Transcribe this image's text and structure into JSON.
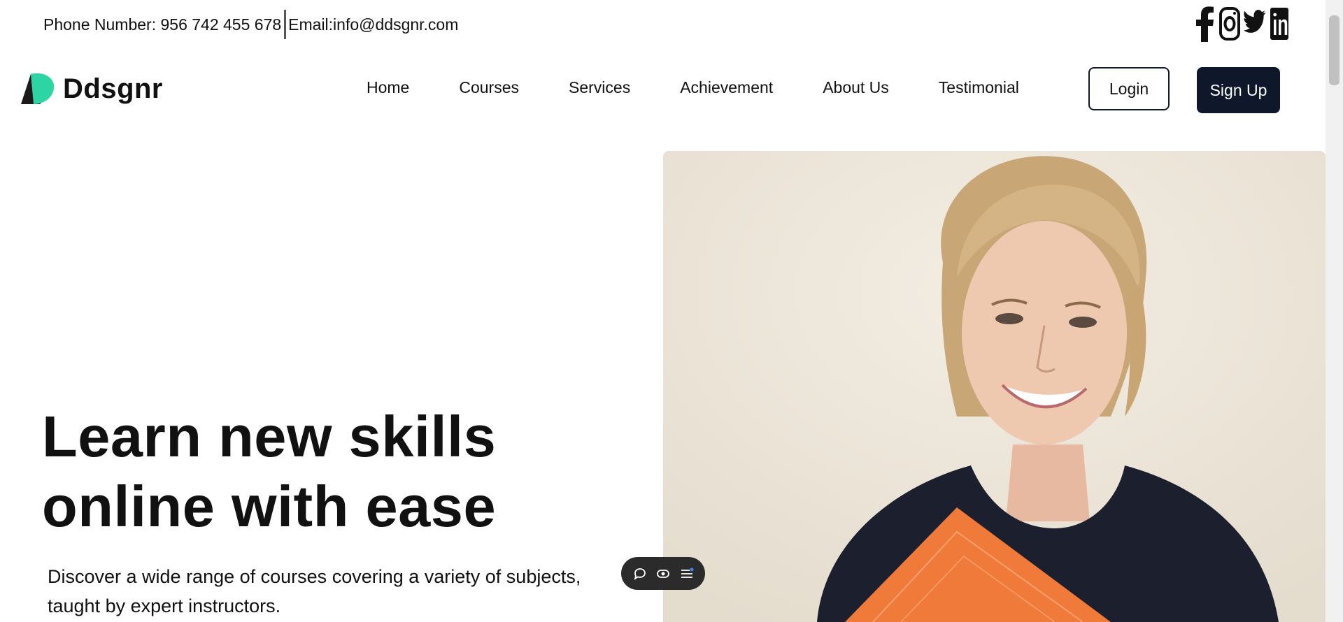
{
  "topbar": {
    "phone": "Phone Number: 956 742 455 678",
    "email": "Email:info@ddsgnr.com"
  },
  "socials": [
    "facebook-icon",
    "instagram-icon",
    "twitter-icon",
    "linkedin-icon"
  ],
  "brand": {
    "name": "Ddsgnr",
    "logo_colors": [
      "#1a1a1a",
      "#2dd4a4"
    ]
  },
  "nav": {
    "items": [
      {
        "label": "Home"
      },
      {
        "label": "Courses"
      },
      {
        "label": "Services"
      },
      {
        "label": "Achievement"
      },
      {
        "label": "About Us"
      },
      {
        "label": "Testimonial"
      }
    ],
    "login_label": "Login",
    "signup_label": "Sign Up"
  },
  "hero": {
    "title_line1": "Learn new skills",
    "title_line2": "online with ease",
    "subtitle_line1": "Discover a wide range of courses covering a variety of subjects,",
    "subtitle_line2": "taught by expert instructors."
  },
  "widget": {
    "icons": [
      "comment-icon",
      "eye-icon",
      "menu-icon"
    ]
  },
  "colors": {
    "primary": "#0f172a",
    "accent": "#2dd4a4",
    "text": "#111111"
  }
}
